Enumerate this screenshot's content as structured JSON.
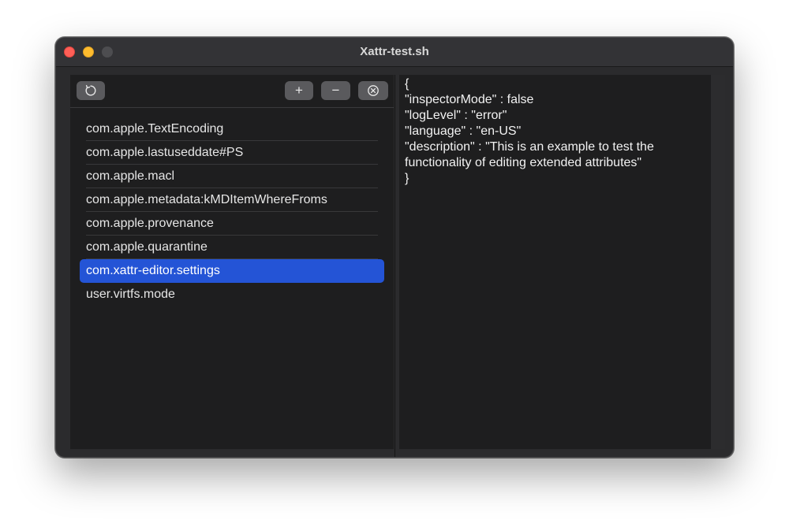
{
  "window": {
    "title": "Xattr-test.sh"
  },
  "toolbar": {
    "refresh_icon": "refresh-icon",
    "add_label": "+",
    "remove_label": "−",
    "clear_icon": "clear-circle-icon"
  },
  "attributes": {
    "items": [
      {
        "label": "com.apple.TextEncoding",
        "selected": false
      },
      {
        "label": "com.apple.lastuseddate#PS",
        "selected": false
      },
      {
        "label": "com.apple.macl",
        "selected": false
      },
      {
        "label": "com.apple.metadata:kMDItemWhereFroms",
        "selected": false
      },
      {
        "label": "com.apple.provenance",
        "selected": false
      },
      {
        "label": "com.apple.quarantine",
        "selected": false
      },
      {
        "label": "com.xattr-editor.settings",
        "selected": true
      },
      {
        "label": "user.virtfs.mode",
        "selected": false
      }
    ]
  },
  "editor": {
    "content": "{\n\"inspectorMode\" : false\n\"logLevel\" : \"error\"\n\"language\" : \"en-US\"\n\"description\" : \"This is an example to test the functionality of editing extended attributes\"\n}"
  },
  "colors": {
    "selection": "#2454d6",
    "close": "#ff5f57",
    "minimize": "#febc2e",
    "zoom_disabled": "#4d4d50"
  }
}
